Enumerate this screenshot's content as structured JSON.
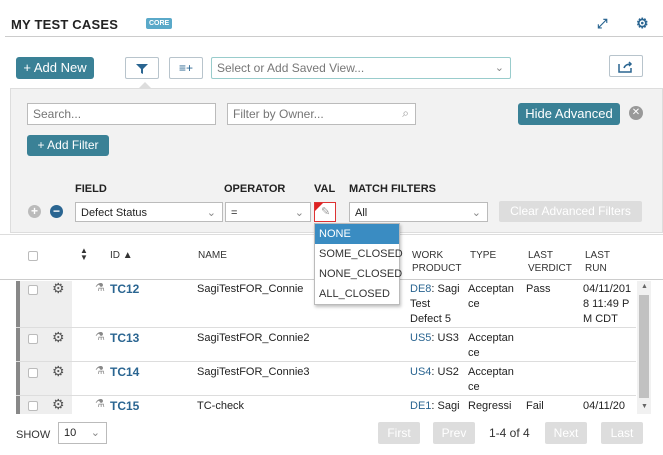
{
  "header": {
    "title": "MY TEST CASES",
    "badge": "CORE"
  },
  "toolbar": {
    "add_new": "+ Add New",
    "saved_view_placeholder": "Select or Add Saved View..."
  },
  "filters": {
    "search_placeholder": "Search...",
    "owner_placeholder": "Filter by Owner...",
    "hide_advanced": "Hide Advanced",
    "add_filter": "+ Add Filter",
    "field_label": "FIELD",
    "operator_label": "OPERATOR",
    "val_label": "VAL",
    "match_label": "MATCH FILTERS",
    "field_value": "Defect Status",
    "operator_value": "=",
    "match_value": "All",
    "clear_advanced": "Clear Advanced Filters"
  },
  "dropdown": {
    "options": [
      "NONE",
      "SOME_CLOSED",
      "NONE_CLOSED",
      "ALL_CLOSED"
    ],
    "selected_index": 0
  },
  "table": {
    "headers": {
      "id": "ID ▲",
      "name": "NAME",
      "work_product": "WORK PRODUCT",
      "type": "TYPE",
      "last_verdict": "LAST VERDICT",
      "last_run": "LAST RUN"
    },
    "rows": [
      {
        "id": "TC12",
        "name": "SagiTestFOR_Connie",
        "wp_id": "DE8",
        "wp_text": ": Sagi Test Defect 5",
        "type": "Acceptance",
        "verdict": "Pass",
        "last_run": "04/11/2018 11:49 PM CDT"
      },
      {
        "id": "TC13",
        "name": "SagiTestFOR_Connie2",
        "wp_id": "US5",
        "wp_text": ": US3",
        "type": "Acceptance",
        "verdict": "",
        "last_run": ""
      },
      {
        "id": "TC14",
        "name": "SagiTestFOR_Connie3",
        "wp_id": "US4",
        "wp_text": ": US2",
        "type": "Acceptance",
        "verdict": "",
        "last_run": ""
      },
      {
        "id": "TC15",
        "name": "TC-check",
        "wp_id": "DE1",
        "wp_text": ": Sagi",
        "type": "Regressi",
        "verdict": "Fail",
        "last_run": "04/11/20"
      }
    ]
  },
  "footer": {
    "show_label": "SHOW",
    "page_size": "10",
    "first": "First",
    "prev": "Prev",
    "range": "1-4 of 4",
    "next": "Next",
    "last": "Last"
  },
  "colors": {
    "accent": "#3a8196",
    "link": "#2a6591",
    "dropdown_selected": "#3a8cc2"
  }
}
